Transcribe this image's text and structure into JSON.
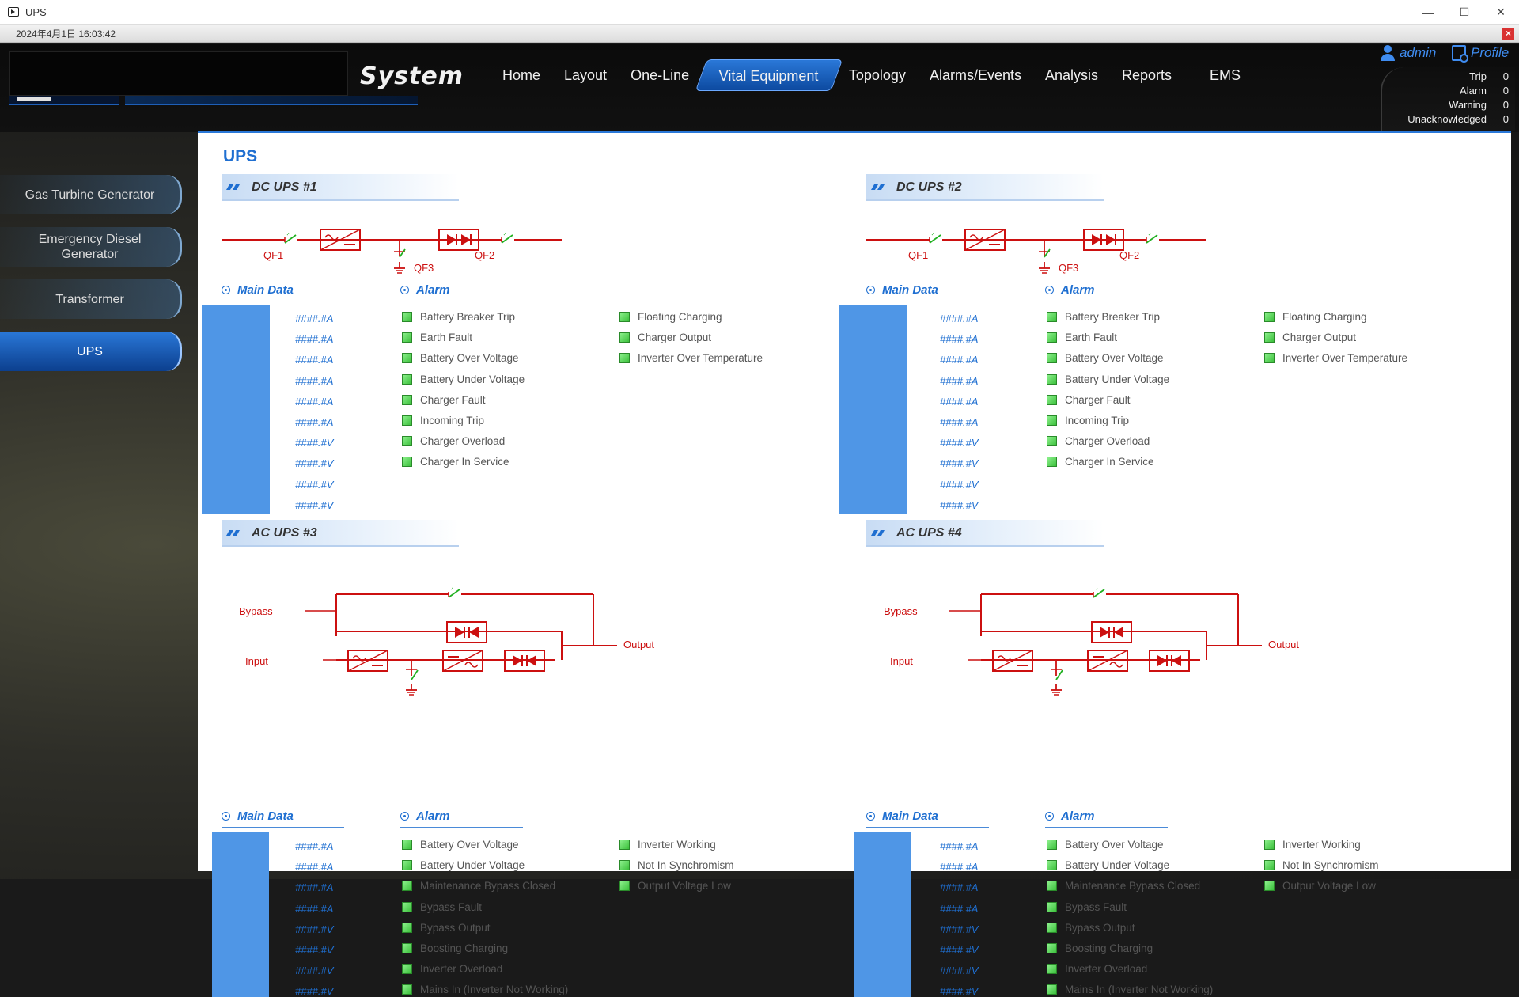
{
  "window": {
    "title": "UPS",
    "minimize": "—",
    "maximize": "☐",
    "close": "✕"
  },
  "datetime": "2024年4月1日 16:03:42",
  "header": {
    "system_title": "System",
    "nav": [
      "Home",
      "Layout",
      "One-Line",
      "Vital Equipment",
      "Topology",
      "Alarms/Events",
      "Analysis",
      "Reports",
      "EMS"
    ],
    "active_nav": "Vital Equipment",
    "user": "admin",
    "profile": "Profile",
    "status": [
      {
        "label": "Trip",
        "value": "0"
      },
      {
        "label": "Alarm",
        "value": "0"
      },
      {
        "label": "Warning",
        "value": "0"
      },
      {
        "label": "Unacknowledged",
        "value": "0"
      }
    ]
  },
  "sidebar": {
    "items": [
      "Gas Turbine Generator",
      "Emergency Diesel Generator",
      "Transformer",
      "UPS"
    ],
    "active": "UPS"
  },
  "page_title": "UPS",
  "common": {
    "main_data": "Main Data",
    "alarm": "Alarm"
  },
  "dc_diagram": {
    "qf1": "QF1",
    "qf2": "QF2",
    "qf3": "QF3"
  },
  "ac_diagram": {
    "bypass": "Bypass",
    "input": "Input",
    "output": "Output"
  },
  "dc_values": [
    "####.#A",
    "####.#A",
    "####.#A",
    "####.#A",
    "####.#A",
    "####.#A",
    "####.#V",
    "####.#V",
    "####.#V",
    "####.#V"
  ],
  "ac_values": [
    "####.#A",
    "####.#A",
    "####.#A",
    "####.#A",
    "####.#V",
    "####.#V",
    "####.#V",
    "####.#V"
  ],
  "dc_alarms_col1": [
    "Battery Breaker Trip",
    "Earth Fault",
    "Battery Over Voltage",
    "Battery Under Voltage",
    "Charger Fault",
    "Incoming Trip",
    "Charger Overload",
    "Charger In Service"
  ],
  "dc_alarms_col2": [
    "Floating Charging",
    "Charger Output",
    "Inverter Over Temperature"
  ],
  "ac_alarms_col1": [
    "Battery Over Voltage",
    "Battery Under Voltage",
    "Maintenance Bypass Closed",
    "Bypass Fault",
    "Bypass Output",
    "Boosting Charging",
    "Inverter Overload",
    "Mains In (Inverter Not Working)"
  ],
  "ac_alarms_col2": [
    "Inverter Working",
    "Not In Synchromism",
    "Output Voltage Low"
  ],
  "panels": {
    "dc1": {
      "title": "DC UPS #1"
    },
    "dc2": {
      "title": "DC UPS #2"
    },
    "ac3": {
      "title": "AC UPS #3"
    },
    "ac4": {
      "title": "AC UPS #4"
    }
  },
  "colors": {
    "accent": "#1f6fd1",
    "diagram": "#cc1010",
    "led_ok": "#3cc03c",
    "data_block": "#4f96e6"
  }
}
